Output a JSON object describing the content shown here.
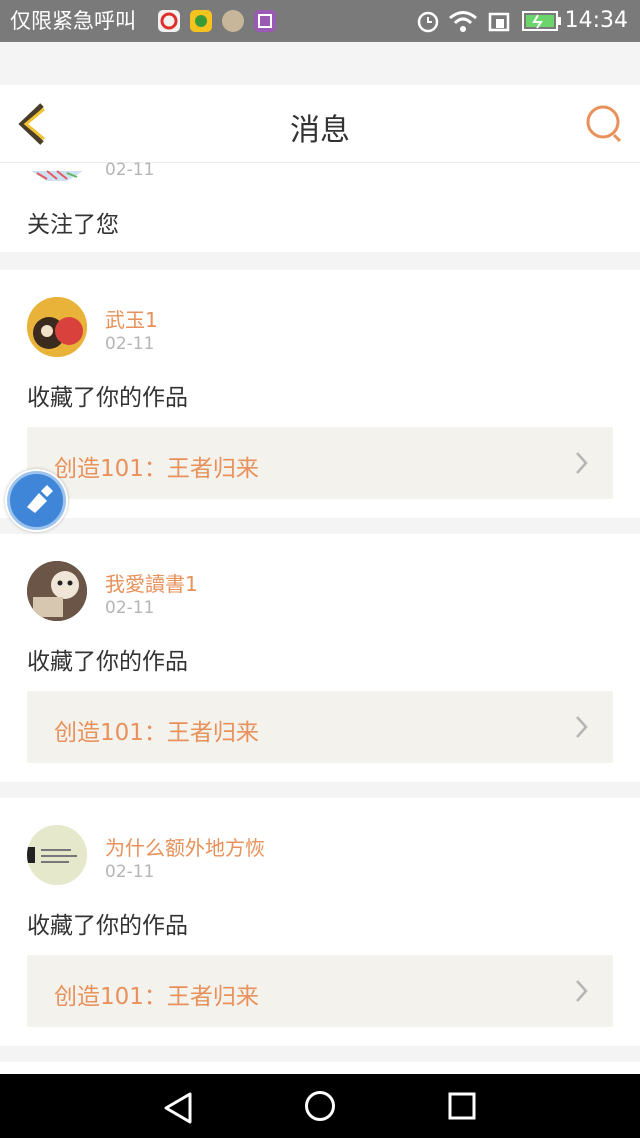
{
  "status_bar": {
    "carrier": "仅限紧急呼叫",
    "app_icons": [
      "weibo-icon",
      "wechat-icon",
      "portrait-app-icon",
      "gallery-app-icon"
    ],
    "system_icons": [
      "alarm-icon",
      "wifi-icon",
      "sim-icon",
      "battery-icon"
    ],
    "time": "14:34"
  },
  "header": {
    "title": "消息",
    "back_icon": "chevron-left-icon",
    "search_icon": "search-icon",
    "accent_color": "#e8915a"
  },
  "messages": [
    {
      "date": "02-11",
      "action": "关注了您"
    },
    {
      "user": "武玉1",
      "date": "02-11",
      "action": "收藏了你的作品",
      "work": "创造101：王者归来"
    },
    {
      "user": "我愛讀書1",
      "date": "02-11",
      "action": "收藏了你的作品",
      "work": "创造101：王者归来"
    },
    {
      "user": "为什么额外地方恢",
      "date": "02-11",
      "action": "收藏了你的作品",
      "work": "创造101：王者归来"
    }
  ],
  "floating_button": {
    "icon": "cleaner-brush-icon"
  },
  "nav_bar": {
    "icons": [
      "nav-back-icon",
      "nav-home-icon",
      "nav-recent-icon"
    ]
  }
}
